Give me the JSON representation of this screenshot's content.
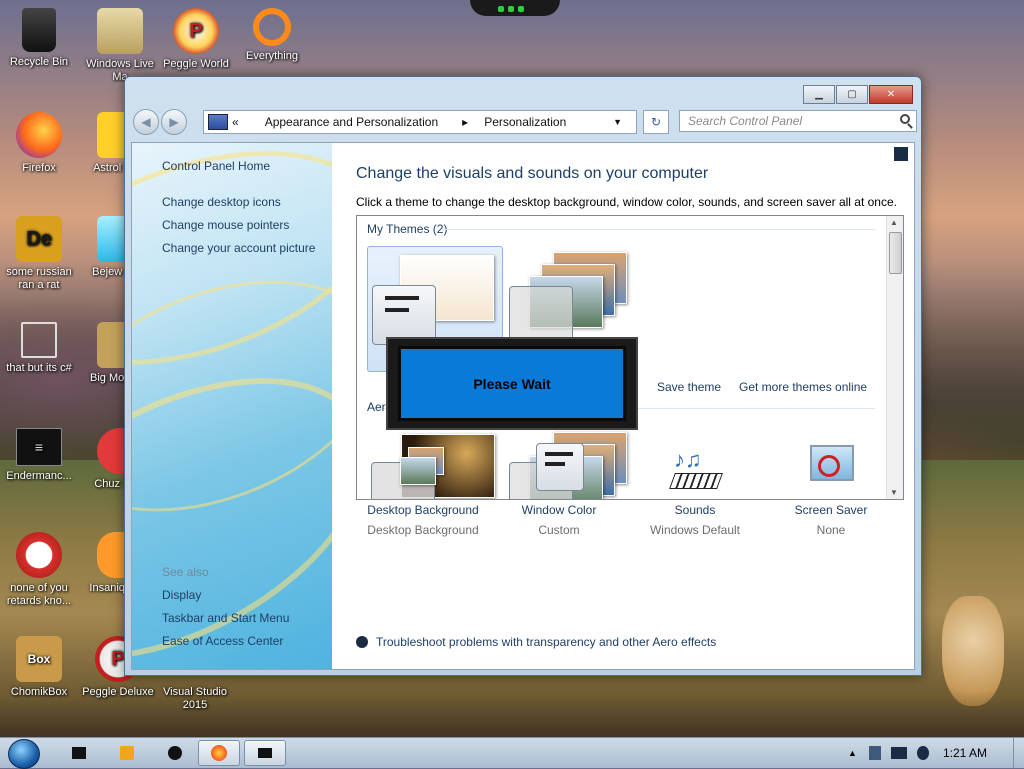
{
  "desktop": {
    "icons": [
      {
        "label": "Recycle Bin",
        "icon": "recycle-bin-icon"
      },
      {
        "label": "Windows Live Ma",
        "icon": "windows-live-mail-icon"
      },
      {
        "label": "Peggle World",
        "icon": "peggle-icon"
      },
      {
        "label": "Everything",
        "icon": "search-magnifier-icon"
      },
      {
        "label": "Firefox",
        "icon": "firefox-icon"
      },
      {
        "label": "Astrol Delu",
        "icon": "astropop-icon"
      },
      {
        "label": "some russian ran a rat",
        "icon": "de-app-icon"
      },
      {
        "label": "Bejew Delu",
        "icon": "bejeweled-icon"
      },
      {
        "label": "that but its c#",
        "icon": "windows-stack-icon"
      },
      {
        "label": "Big Mo Delu",
        "icon": "bigmoney-icon"
      },
      {
        "label": "Endermanc...",
        "icon": "terminal-icon"
      },
      {
        "label": "Chuz Delu",
        "icon": "chuzzle-icon"
      },
      {
        "label": "none of you retards kno...",
        "icon": "dragon-icon"
      },
      {
        "label": "Insaniq Delu",
        "icon": "insaniquarium-icon"
      },
      {
        "label": "ChomikBox",
        "icon": "chomikbox-icon"
      },
      {
        "label": "Peggle Deluxe",
        "icon": "peggle-deluxe-icon"
      },
      {
        "label": "Visual Studio 2015",
        "icon": "visual-studio-icon"
      }
    ]
  },
  "window": {
    "address": {
      "crumb_root": "«",
      "crumb1": "Appearance and Personalization",
      "crumb2": "Personalization"
    },
    "search_placeholder": "Search Control Panel",
    "sidebar": {
      "home": "Control Panel Home",
      "links": [
        "Change desktop icons",
        "Change mouse pointers",
        "Change your account picture"
      ],
      "see_also": "See also",
      "see_also_links": [
        "Display",
        "Taskbar and Start Menu",
        "Ease of Access Center"
      ]
    },
    "main": {
      "heading": "Change the visuals and sounds on your computer",
      "subtitle": "Click a theme to change the desktop background, window color, sounds, and screen saver all at once.",
      "my_themes": "My Themes (2)",
      "aero_group": "Aero",
      "save_theme": "Save theme",
      "get_more": "Get more themes online",
      "tools": [
        {
          "title": "Desktop Background",
          "value": "Desktop Background",
          "icon": "desktop-background-icon"
        },
        {
          "title": "Window Color",
          "value": "Custom",
          "icon": "window-color-icon"
        },
        {
          "title": "Sounds",
          "value": "Windows Default",
          "icon": "sounds-icon"
        },
        {
          "title": "Screen Saver",
          "value": "None",
          "icon": "screen-saver-icon"
        }
      ],
      "troubleshoot": "Troubleshoot problems with transparency and other Aero effects"
    }
  },
  "dialog": {
    "text": "Please Wait"
  },
  "taskbar": {
    "clock": "1:21 AM"
  },
  "colors": {
    "link": "#1e3f66",
    "wait_bg": "#0a7ad8",
    "accent": "#4fb3df"
  }
}
